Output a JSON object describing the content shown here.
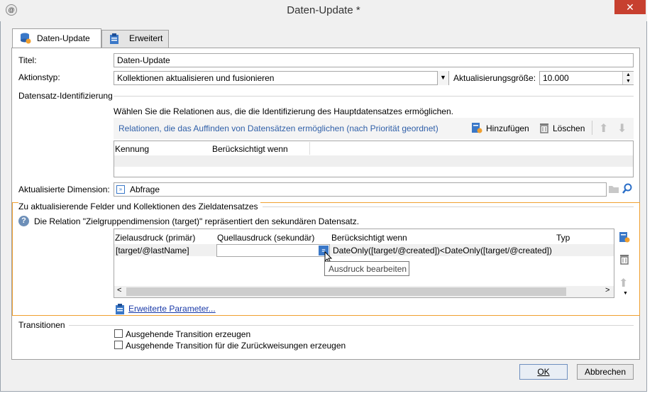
{
  "window": {
    "title": "Daten-Update *",
    "close_glyph": "✕"
  },
  "tabs": [
    {
      "label": "Daten-Update",
      "icon": "database-icon",
      "active": true
    },
    {
      "label": "Erweitert",
      "icon": "clipboard-icon",
      "active": false
    }
  ],
  "form": {
    "title_label": "Titel:",
    "title_value": "Daten-Update",
    "action_label": "Aktionstyp:",
    "action_value": "Kollektionen aktualisieren und fusionieren",
    "batch_label": "Aktualisierungsgröße:",
    "batch_value": "10.000"
  },
  "identification": {
    "group_label": "Datensatz-Identifizierung",
    "hint": "Wählen Sie die Relationen aus, die die Identifizierung des Hauptdatensatzes ermöglichen.",
    "relations_label": "Relationen, die das Auffinden von Datensätzen ermöglichen (nach Priorität geordnet)",
    "add_label": "Hinzufügen",
    "delete_label": "Löschen",
    "columns": [
      "Kennung",
      "Berücksichtigt wenn"
    ]
  },
  "dimension": {
    "label": "Aktualisierte Dimension:",
    "value": "Abfrage"
  },
  "fields": {
    "group_label": "Zu aktualisierende Felder und Kollektionen des Zieldatensatzes",
    "info": "Die Relation \"Zielgruppendimension (target)\" repräsentiert den sekundären Datensatz.",
    "columns": [
      "Zielausdruck (primär)",
      "Quellausdruck (sekundär)",
      "Berücksichtigt wenn",
      "Typ"
    ],
    "rows": [
      {
        "target": "[target/@lastName]",
        "source": "",
        "condition": "DateOnly([target/@created])<DateOnly([target/@created])",
        "type": ""
      }
    ],
    "tooltip": "Ausdruck bearbeiten",
    "advanced_link": "Erweiterte Parameter..."
  },
  "transitions": {
    "group_label": "Transitionen",
    "outgoing": {
      "label": "Ausgehende Transition erzeugen",
      "checked": false
    },
    "rejects": {
      "label": "Ausgehende Transition für die Zurückweisungen erzeugen",
      "checked": false
    }
  },
  "buttons": {
    "ok": "OK",
    "cancel": "Abbrechen"
  },
  "colors": {
    "highlight_border": "#f0a030",
    "link": "#1a3aa8",
    "close": "#c7402f"
  }
}
